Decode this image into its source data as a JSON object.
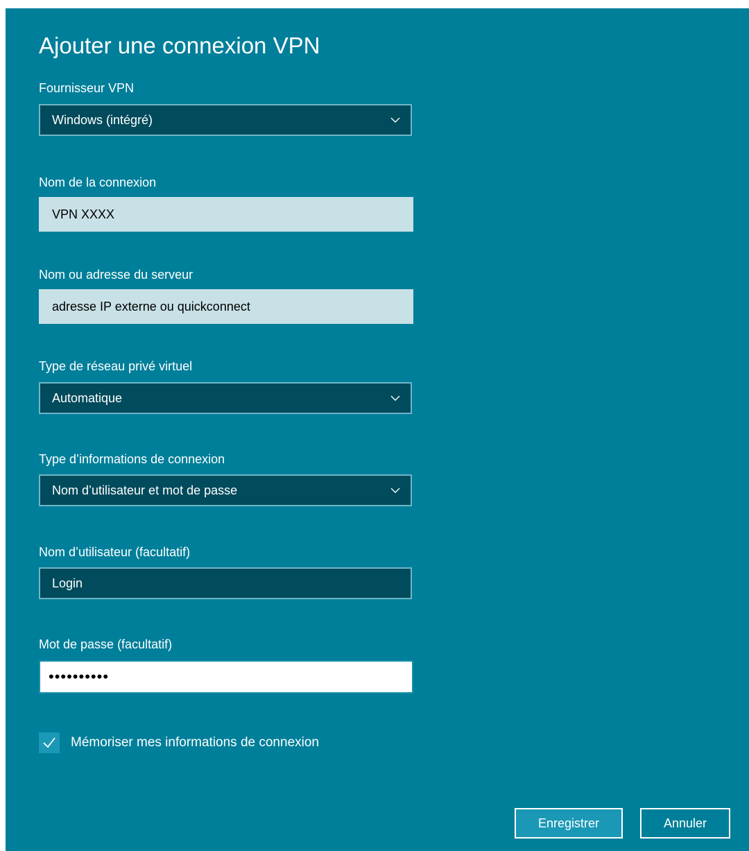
{
  "dialog": {
    "title": "Ajouter une connexion VPN"
  },
  "fields": {
    "provider": {
      "label": "Fournisseur VPN",
      "value": "Windows (intégré)"
    },
    "connection_name": {
      "label": "Nom de la connexion",
      "value": "VPN XXXX"
    },
    "server": {
      "label": "Nom ou adresse du serveur",
      "value": "adresse IP externe ou quickconnect"
    },
    "vpn_type": {
      "label": "Type de réseau privé virtuel",
      "value": "Automatique"
    },
    "signin_type": {
      "label": "Type d’informations de connexion",
      "value": "Nom d’utilisateur et mot de passe"
    },
    "username": {
      "label": "Nom d’utilisateur (facultatif)",
      "value": "Login"
    },
    "password": {
      "label": "Mot de passe (facultatif)",
      "value": "••••••••••"
    }
  },
  "remember": {
    "label": "Mémoriser mes informations de connexion",
    "checked": true
  },
  "buttons": {
    "save": "Enregistrer",
    "cancel": "Annuler"
  },
  "colors": {
    "background": "#007f9a",
    "field_dark": "#004b5c",
    "field_light": "#c8e1e6",
    "accent": "#1b98b6"
  },
  "icons": {
    "dropdown": "chevron-down-icon",
    "checkbox": "checkmark-icon"
  }
}
